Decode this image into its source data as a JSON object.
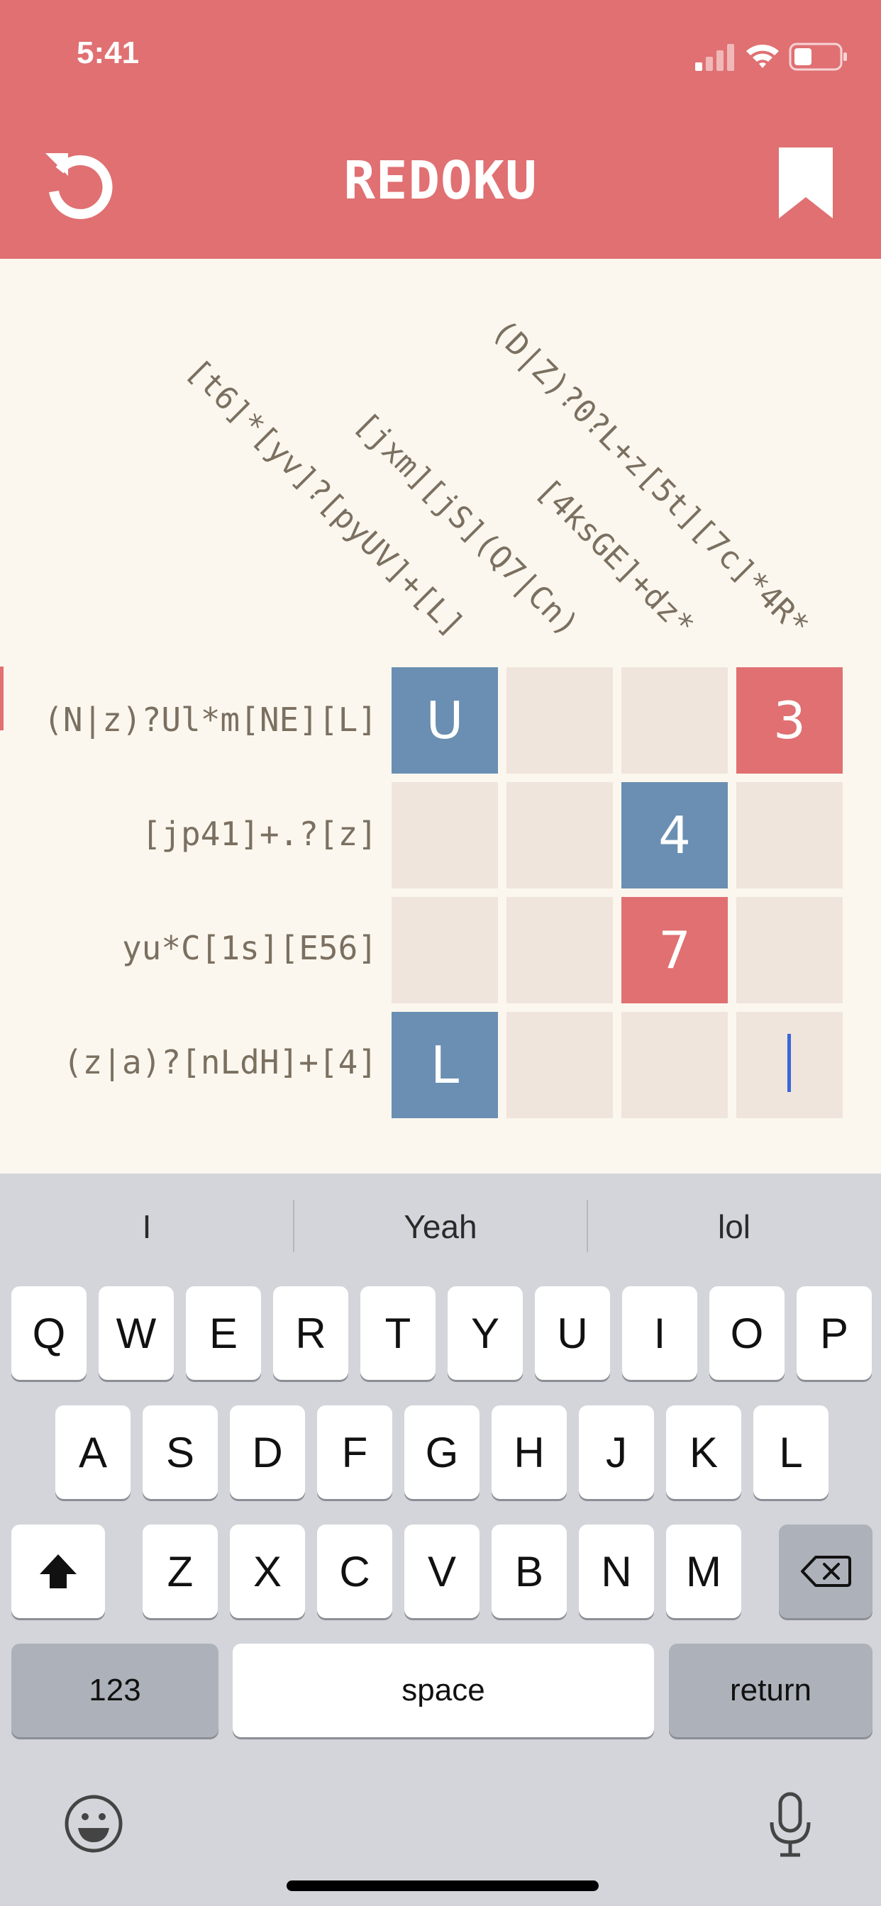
{
  "status": {
    "time": "5:41"
  },
  "header": {
    "title": "REDOKU",
    "left_icon": "reset-icon",
    "right_icon": "bookmark-icon"
  },
  "colors": {
    "header": "#E07072",
    "cell_blue": "#6A8FB2",
    "cell_red": "#E07072",
    "cell_empty": "#EFE5DC",
    "background": "#FBF7EF"
  },
  "puzzle": {
    "column_clues": [
      "[t6]*[yv]?[pyUV]+[L]",
      "[jxm][jS](Q7|Cn)",
      "[4ksGE]+dz*",
      "(D|Z)?0?L+z[5t][7c]*4R*"
    ],
    "row_clues": [
      "(N|z)?Ul*m[NE][L]",
      "[jp41]+.?[z]",
      "yu*C[1s][E56]",
      "(z|a)?[nLdH]+[4]"
    ],
    "cells": [
      [
        "U",
        "",
        "",
        "3"
      ],
      [
        "",
        "",
        "4",
        ""
      ],
      [
        "",
        "",
        "7",
        ""
      ],
      [
        "L",
        "",
        "",
        ""
      ]
    ]
  },
  "keyboard": {
    "suggestions": [
      "I",
      "Yeah",
      "lol"
    ],
    "row1": [
      "Q",
      "W",
      "E",
      "R",
      "T",
      "Y",
      "U",
      "I",
      "O",
      "P"
    ],
    "row2": [
      "A",
      "S",
      "D",
      "F",
      "G",
      "H",
      "J",
      "K",
      "L"
    ],
    "row3": [
      "Z",
      "X",
      "C",
      "V",
      "B",
      "N",
      "M"
    ],
    "numbers_label": "123",
    "space_label": "space",
    "return_label": "return"
  }
}
